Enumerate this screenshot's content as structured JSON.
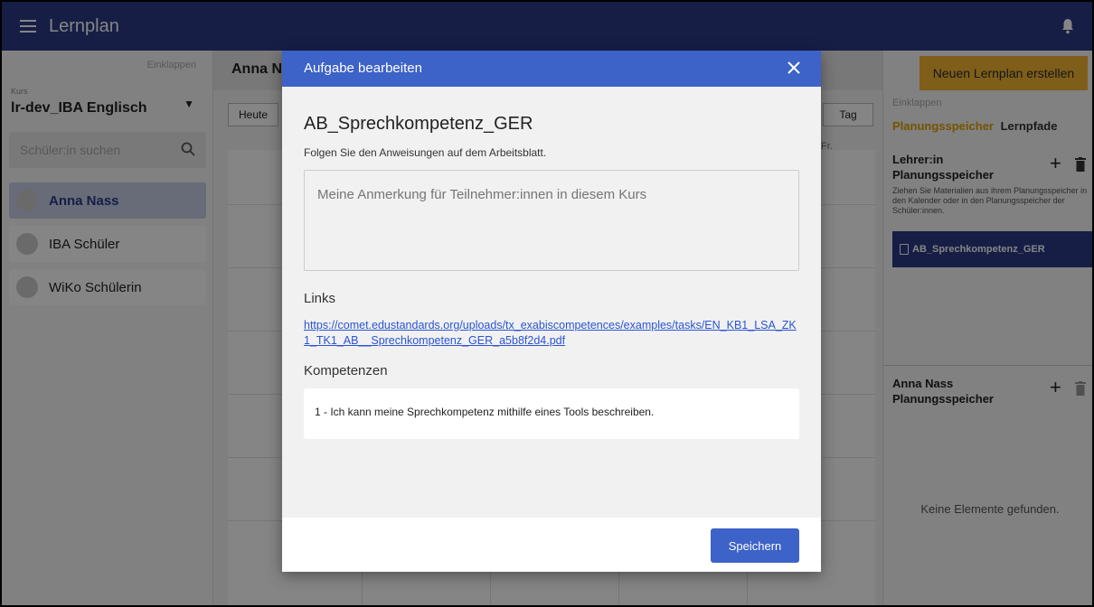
{
  "appbar": {
    "title": "Lernplan",
    "menu_icon": "hamburger-icon",
    "bell_icon": "bell-icon"
  },
  "left": {
    "collapse_label": "Einklappen",
    "kurs_label": "Kurs",
    "kurs_value": "lr-dev_IBA Englisch",
    "search_placeholder": "Schüler:in suchen",
    "students": [
      {
        "name": "Anna Nass",
        "active": true
      },
      {
        "name": "IBA Schüler",
        "active": false
      },
      {
        "name": "WiKo Schülerin",
        "active": false
      }
    ]
  },
  "center": {
    "student_heading": "Anna N",
    "today_button": "Heute",
    "day_button": "Tag",
    "weekday_label": "Fr."
  },
  "right": {
    "new_plan_button": "Neuen Lernplan erstellen",
    "collapse_label": "Einklappen",
    "tab_planning": "Planungsspeicher",
    "tab_paths": "Lernpfade",
    "teacher_storage_title": "Lehrer:in Planungsspeicher",
    "hint": "Ziehen Sie Materialien aus ihrem Planungsspeicher in den Kalender oder in den Planungsspeicher der Schüler:innen.",
    "chip_label": "AB_Sprechkompetenz_GER",
    "student_storage_title": "Anna Nass Planungsspeicher",
    "empty_text": "Keine Elemente gefunden."
  },
  "modal": {
    "header_title": "Aufgabe bearbeiten",
    "task_title": "AB_Sprechkompetenz_GER",
    "task_description": "Folgen Sie den Anweisungen auf dem Arbeitsblatt.",
    "note_placeholder": "Meine Anmerkung für Teilnehmer:innen in diesem Kurs",
    "links_heading": "Links",
    "link_url": "https://comet.edustandards.org/uploads/tx_exabiscompetences/examples/tasks/EN_KB1_LSA_ZK1_TK1_AB__Sprechkompetenz_GER_a5b8f2d4.pdf",
    "competences_heading": "Kompetenzen",
    "competence_item": "1 - Ich kann meine Sprechkompetenz mithilfe eines Tools beschreiben.",
    "save_button": "Speichern"
  },
  "colors": {
    "appbar": "#2b3a87",
    "modal_header": "#3d62c8",
    "accent": "#f2b531"
  }
}
